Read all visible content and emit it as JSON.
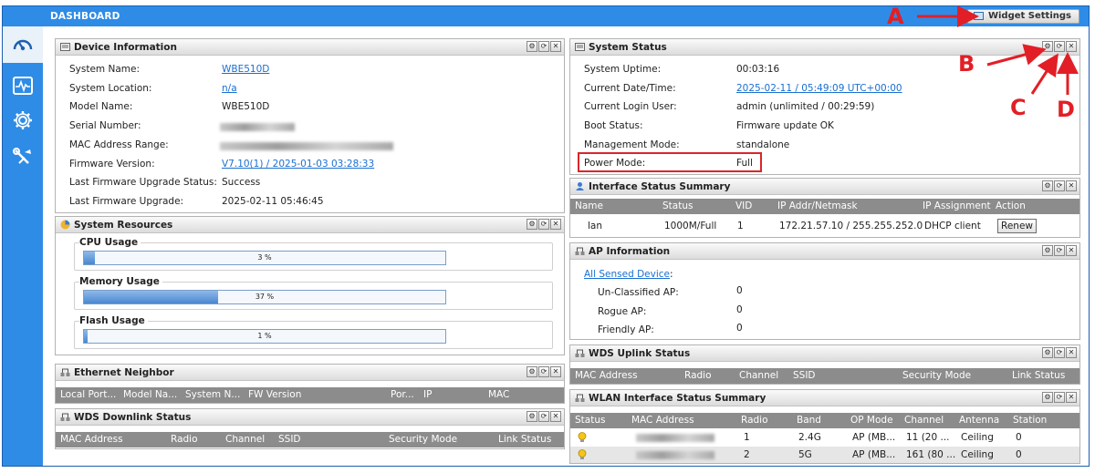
{
  "topbar": {
    "title": "DASHBOARD",
    "widget_settings": "Widget Settings"
  },
  "callouts": {
    "a": "A",
    "b": "B",
    "c": "C",
    "d": "D"
  },
  "panel_controls": {
    "settings": "⚙",
    "refresh": "⟳",
    "close": "✕"
  },
  "device_info": {
    "title": "Device Information",
    "rows": [
      {
        "label": "System Name:",
        "value": "WBE510D",
        "link": true
      },
      {
        "label": "System Location:",
        "value": "n/a",
        "link": true
      },
      {
        "label": "Model Name:",
        "value": "WBE510D"
      },
      {
        "label": "Serial Number:",
        "value": ""
      },
      {
        "label": "MAC Address Range:",
        "value": ""
      },
      {
        "label": "Firmware Version:",
        "value": "V7.10(1) / 2025-01-03 03:28:33",
        "link": true
      },
      {
        "label": "Last Firmware Upgrade Status:",
        "value": "Success"
      },
      {
        "label": "Last Firmware Upgrade:",
        "value": "2025-02-11 05:46:45"
      }
    ]
  },
  "system_resources": {
    "title": "System Resources",
    "items": [
      {
        "label": "CPU Usage",
        "percent": 3,
        "text": "3 %"
      },
      {
        "label": "Memory Usage",
        "percent": 37,
        "text": "37 %"
      },
      {
        "label": "Flash Usage",
        "percent": 1,
        "text": "1 %"
      }
    ]
  },
  "ethernet_neighbor": {
    "title": "Ethernet Neighbor",
    "columns": [
      "Local Port...",
      "Model Na...",
      "System N...",
      "FW Version",
      "Por...",
      "IP",
      "MAC"
    ]
  },
  "wds_downlink": {
    "title": "WDS Downlink Status",
    "columns": [
      "MAC Address",
      "Radio",
      "Channel",
      "SSID",
      "Security Mode",
      "Link Status"
    ]
  },
  "system_status": {
    "title": "System Status",
    "rows": [
      {
        "label": "System Uptime:",
        "value": "00:03:16"
      },
      {
        "label": "Current Date/Time:",
        "value": "2025-02-11 / 05:49:09 UTC+00:00",
        "link": true
      },
      {
        "label": "Current Login User:",
        "value": "admin (unlimited / 00:29:59)"
      },
      {
        "label": "Boot Status:",
        "value": "Firmware update OK"
      },
      {
        "label": "Management Mode:",
        "value": "standalone"
      },
      {
        "label": "Power Mode:",
        "value": "Full"
      }
    ]
  },
  "interface_status": {
    "title": "Interface Status Summary",
    "columns": [
      "Name",
      "Status",
      "VID",
      "IP Addr/Netmask",
      "IP Assignment",
      "Action"
    ],
    "row": {
      "name": "lan",
      "status": "1000M/Full",
      "vid": "1",
      "ip": "172.21.57.10 / 255.255.252.0",
      "assignment": "DHCP client",
      "action": "Renew"
    }
  },
  "ap_info": {
    "title": "AP Information",
    "link": "All Sensed Device",
    "colon": ":",
    "rows": [
      {
        "label": "Un-Classified AP:",
        "value": "0"
      },
      {
        "label": "Rogue AP:",
        "value": "0"
      },
      {
        "label": "Friendly AP:",
        "value": "0"
      }
    ]
  },
  "wds_uplink": {
    "title": "WDS Uplink Status",
    "columns": [
      "MAC Address",
      "Radio",
      "Channel",
      "SSID",
      "Security Mode",
      "Link Status"
    ]
  },
  "wlan_summary": {
    "title": "WLAN Interface Status Summary",
    "columns": [
      "Status",
      "MAC Address",
      "Radio",
      "Band",
      "OP Mode",
      "Channel",
      "Antenna",
      "Station"
    ],
    "rows": [
      {
        "radio": "1",
        "band": "2.4G",
        "op_mode": "AP (MB...",
        "channel": "11 (20 ...",
        "antenna": "Ceiling",
        "station": "0"
      },
      {
        "radio": "2",
        "band": "5G",
        "op_mode": "AP (MB...",
        "channel": "161 (80 ...",
        "antenna": "Ceiling",
        "station": "0"
      }
    ]
  },
  "colors": {
    "accent": "#2e8ce6",
    "callout": "#e21f26",
    "table_header": "#8c8c8c"
  }
}
